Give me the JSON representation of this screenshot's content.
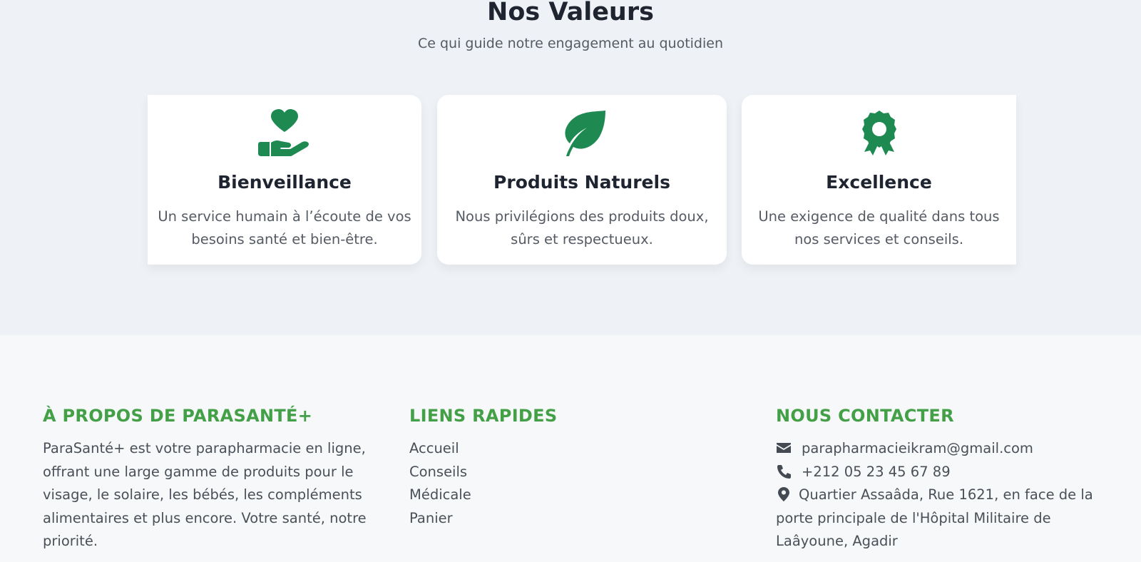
{
  "values_section": {
    "title": "Nos Valeurs",
    "subtitle": "Ce qui guide notre engagement au quotidien",
    "accent_color": "#1e8a52",
    "cards": [
      {
        "icon": "hand-heart-icon",
        "title": "Bienveillance",
        "description": "Un service humain à l’écoute de vos besoins santé et bien-être."
      },
      {
        "icon": "leaf-icon",
        "title": "Produits Naturels",
        "description": "Nous privilégions des produits doux, sûrs et respectueux."
      },
      {
        "icon": "award-icon",
        "title": "Excellence",
        "description": "Une exigence de qualité dans tous nos services et conseils."
      }
    ]
  },
  "footer": {
    "heading_color": "#43a047",
    "about": {
      "heading": "À PROPOS DE PARASANTÉ+",
      "text": "ParaSanté+ est votre parapharmacie en ligne, offrant une large gamme de produits pour le visage, le solaire, les bébés, les compléments alimentaires et plus encore. Votre santé, notre priorité."
    },
    "links": {
      "heading": "LIENS RAPIDES",
      "items": [
        "Accueil",
        "Conseils",
        "Médicale",
        "Panier"
      ]
    },
    "contact": {
      "heading": "NOUS CONTACTER",
      "email": "parapharmacieikram@gmail.com",
      "phone": "+212 05 23 45 67 89",
      "address": "Quartier Assaâda, Rue 1621, en face de la porte principale de l'Hôpital Militaire de Laâyoune, Agadir"
    }
  }
}
